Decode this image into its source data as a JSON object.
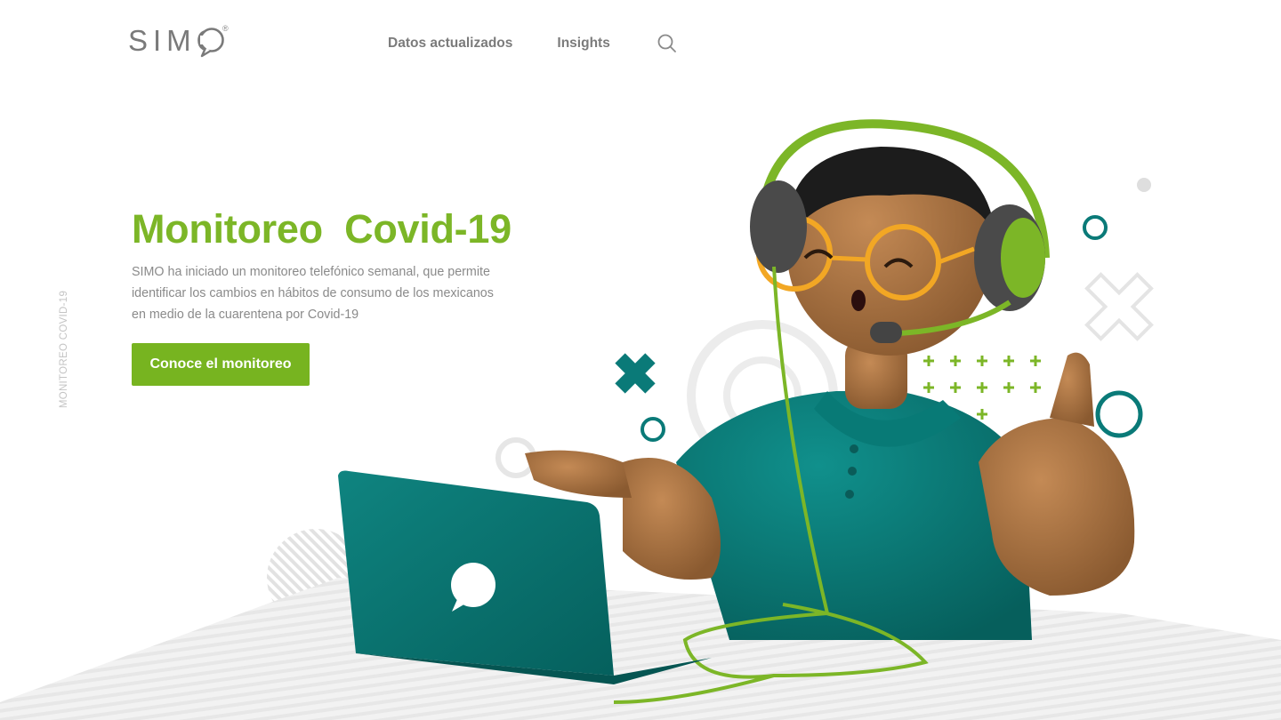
{
  "brand": {
    "name": "SIMO",
    "reg": "®"
  },
  "nav": {
    "items": [
      "Datos actualizados",
      "Insights"
    ],
    "search_icon": "search-icon"
  },
  "side_label": "MONITOREO COVID-19",
  "hero": {
    "title": "Monitoreo  Covid-19",
    "description": "SIMO ha iniciado un monitoreo telefónico semanal, que permite identificar los cambios en hábitos de consumo de los mexicanos en medio de la cuarentena por Covid-19",
    "cta_label": "Conoce el monitoreo"
  },
  "colors": {
    "accent_green": "#7cb627",
    "button_green": "#77b420",
    "teal": "#0a7a78",
    "gray_text": "#8a8a8a",
    "logo_gray": "#7a7a7a"
  },
  "illustration": {
    "subject": "3D character with headset and glasses waving at laptop",
    "icons": [
      "speech-bubble-icon",
      "cross-icon",
      "plus-icon",
      "ring-icon"
    ]
  }
}
